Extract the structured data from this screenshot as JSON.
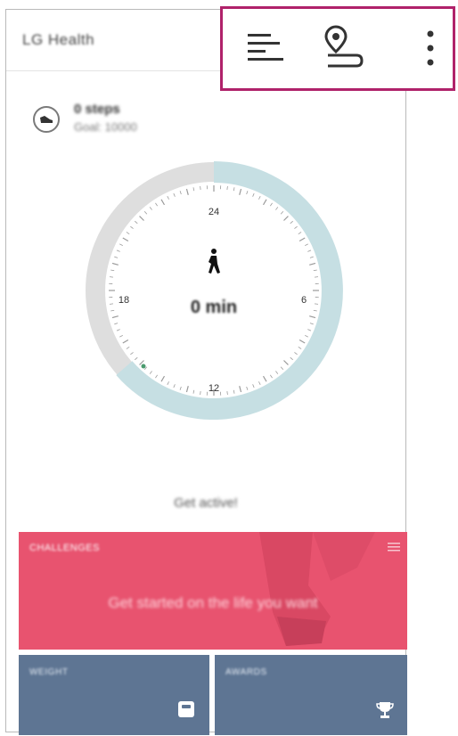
{
  "app": {
    "title": "LG Health"
  },
  "toolbar": {
    "icons": [
      "summary-list-icon",
      "location-pin-icon",
      "more-vert-icon"
    ],
    "accent_color": "#b0226a"
  },
  "summary": {
    "steps": "0 steps",
    "goal": "Goal: 10000",
    "icon": "walking-shoe-icon"
  },
  "dial": {
    "active_minutes": "0 min",
    "hour_labels": {
      "top": "24",
      "right": "6",
      "bottom": "12",
      "left": "18"
    },
    "progress_color": "#c6dfe3",
    "track_color": "#dedede"
  },
  "status": {
    "message": "Get active!"
  },
  "challenges": {
    "label": "CHALLENGES",
    "text": "Get started on the life you want",
    "color": "#e8536f"
  },
  "tiles": [
    {
      "label": "WEIGHT",
      "icon": "scale-icon",
      "color": "#5e7593"
    },
    {
      "label": "AWARDS",
      "icon": "trophy-icon",
      "color": "#5e7593"
    }
  ]
}
